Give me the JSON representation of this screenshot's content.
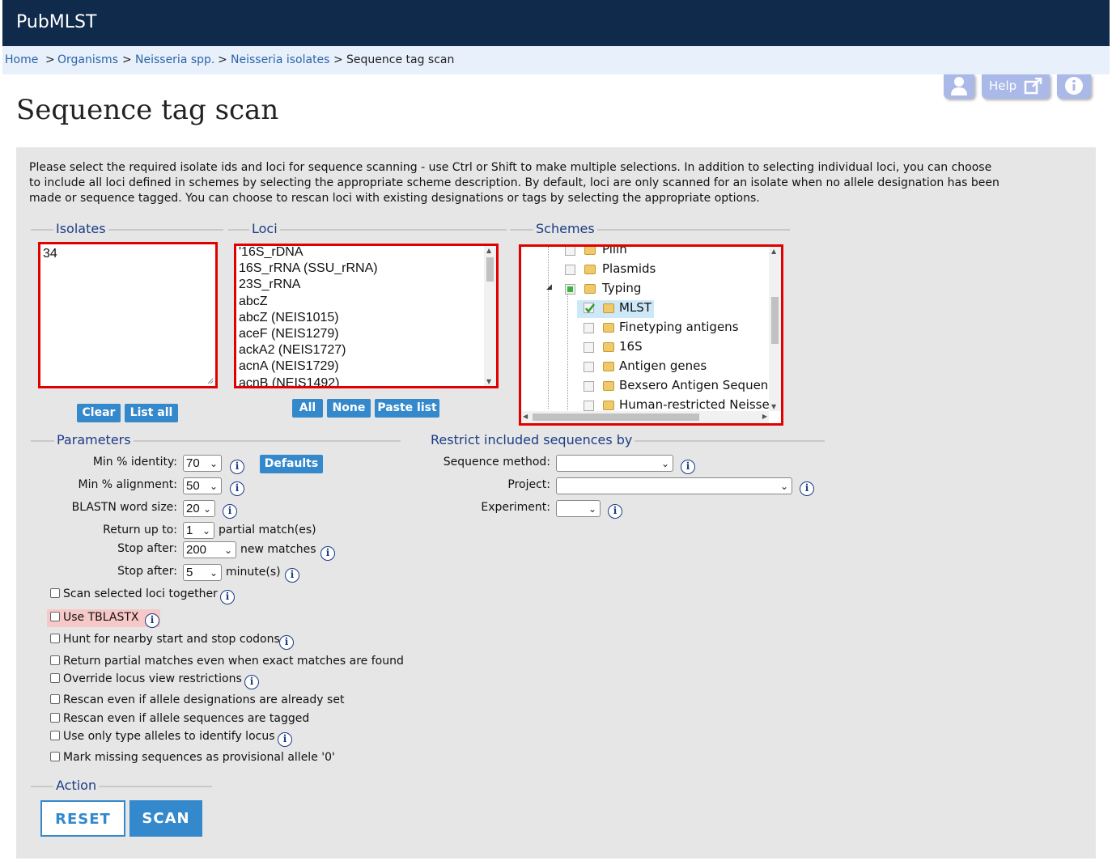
{
  "app": {
    "title": "PubMLST"
  },
  "breadcrumb": [
    "Home",
    "Organisms",
    "Neisseria spp.",
    "Neisseria isolates",
    "Sequence tag scan"
  ],
  "toolbar": {
    "help_label": "Help"
  },
  "page": {
    "title": "Sequence tag scan",
    "intro": "Please select the required isolate ids and loci for sequence scanning - use Ctrl or Shift to make multiple selections. In addition to selecting individual loci, you can choose to include all loci defined in schemes by selecting the appropriate scheme description. By default, loci are only scanned for an isolate when no allele designation has been made or sequence tagged. You can choose to rescan loci with existing designations or tags by selecting the appropriate options."
  },
  "isolates": {
    "legend": "Isolates",
    "value": "34",
    "clear_label": "Clear",
    "list_all_label": "List all"
  },
  "loci": {
    "legend": "Loci",
    "items": [
      "'16S_rDNA",
      "16S_rRNA (SSU_rRNA)",
      "23S_rRNA",
      "abcZ",
      "abcZ (NEIS1015)",
      "aceF (NEIS1279)",
      "ackA2 (NEIS1727)",
      "acnA (NEIS1729)",
      "acnB (NEIS1492)"
    ],
    "all_label": "All",
    "none_label": "None",
    "paste_label": "Paste list"
  },
  "schemes": {
    "legend": "Schemes",
    "nodes": [
      {
        "label": "Pilin",
        "level": 1
      },
      {
        "label": "Plasmids",
        "level": 1
      },
      {
        "label": "Typing",
        "level": 1
      },
      {
        "label": "MLST",
        "level": 2,
        "checked": true
      },
      {
        "label": "Finetyping antigens",
        "level": 2
      },
      {
        "label": "16S",
        "level": 2
      },
      {
        "label": "Antigen genes",
        "level": 2
      },
      {
        "label": "Bexsero Antigen Sequence",
        "level": 2
      },
      {
        "label": "Human-restricted Neisseria",
        "level": 2
      }
    ]
  },
  "parameters": {
    "legend": "Parameters",
    "min_identity": {
      "label": "Min % identity:",
      "value": "70"
    },
    "defaults_label": "Defaults",
    "min_alignment": {
      "label": "Min % alignment:",
      "value": "50"
    },
    "word_size": {
      "label": "BLASTN word size:",
      "value": "20"
    },
    "return_up_to": {
      "label": "Return up to:",
      "value": "1",
      "suffix": "partial match(es)"
    },
    "stop_after_matches": {
      "label": "Stop after:",
      "value": "200",
      "suffix": "new matches"
    },
    "stop_after_minutes": {
      "label": "Stop after:",
      "value": "5",
      "suffix": "minute(s)"
    },
    "checkboxes": [
      "Scan selected loci together",
      "Use TBLASTX",
      "Hunt for nearby start and stop codons",
      "Return partial matches even when exact matches are found",
      "Override locus view restrictions",
      "Rescan even if allele designations are already set",
      "Rescan even if allele sequences are tagged",
      "Use only type alleles to identify locus",
      "Mark missing sequences as provisional allele '0'"
    ]
  },
  "restrict": {
    "legend": "Restrict included sequences by",
    "sequence_method_label": "Sequence method:",
    "project_label": "Project:",
    "experiment_label": "Experiment:"
  },
  "action": {
    "legend": "Action",
    "reset_label": "RESET",
    "scan_label": "SCAN"
  },
  "colors": {
    "header": "#0f2a4a",
    "accent": "#3488cc",
    "legend": "#1b3c86",
    "highlight_red": "#e00000"
  }
}
